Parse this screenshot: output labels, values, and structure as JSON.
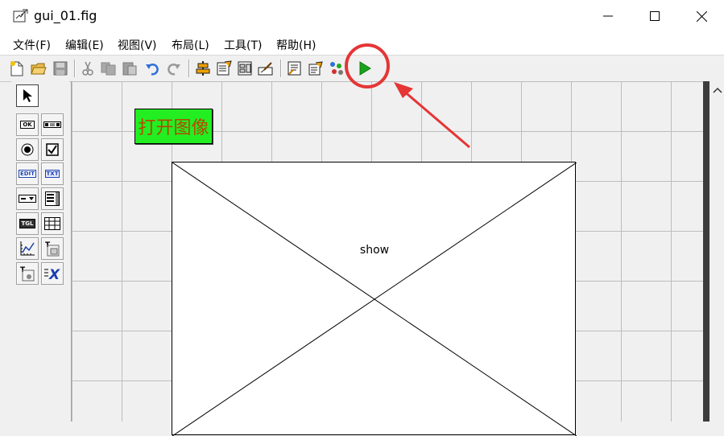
{
  "window": {
    "title": "gui_01.fig",
    "controls": {
      "minimize": "—",
      "maximize": "☐",
      "close": "✕"
    }
  },
  "menubar": {
    "items": [
      {
        "label": "文件(F)"
      },
      {
        "label": "编辑(E)"
      },
      {
        "label": "视图(V)"
      },
      {
        "label": "布局(L)"
      },
      {
        "label": "工具(T)"
      },
      {
        "label": "帮助(H)"
      }
    ]
  },
  "toolbar": {
    "buttons": [
      "new-file-icon",
      "open-folder-icon",
      "save-icon",
      "cut-icon",
      "copy-icon",
      "paste-icon",
      "undo-icon",
      "redo-icon",
      "align-objects-icon",
      "menu-editor-icon",
      "tab-order-icon",
      "toolbar-editor-icon",
      "editor-icon",
      "property-inspector-icon",
      "object-browser-icon",
      "run-figure-icon"
    ],
    "run_color": "#1aa31a",
    "highlight_color": "#e53535"
  },
  "palette": {
    "tools": [
      {
        "icon": "select-arrow-icon",
        "text": ""
      },
      {
        "icon": "push-button-icon",
        "text": "OK"
      },
      {
        "icon": "slider-icon",
        "text": ""
      },
      {
        "icon": "radio-button-icon",
        "text": ""
      },
      {
        "icon": "checkbox-icon",
        "text": ""
      },
      {
        "icon": "edit-text-icon",
        "text": "EDIT"
      },
      {
        "icon": "static-text-icon",
        "text": "TXT"
      },
      {
        "icon": "popup-menu-icon",
        "text": ""
      },
      {
        "icon": "listbox-icon",
        "text": ""
      },
      {
        "icon": "toggle-button-icon",
        "text": "TGL"
      },
      {
        "icon": "table-icon",
        "text": ""
      },
      {
        "icon": "axes-icon",
        "text": ""
      },
      {
        "icon": "panel-icon",
        "text": "T"
      },
      {
        "icon": "button-group-icon",
        "text": "T"
      },
      {
        "icon": "activex-control-icon",
        "text": "X"
      }
    ]
  },
  "canvas": {
    "open_button_label": "打开图像",
    "open_button_bg": "#22ee22",
    "open_button_text_color": "#b24a00",
    "axes_tag": "show"
  }
}
